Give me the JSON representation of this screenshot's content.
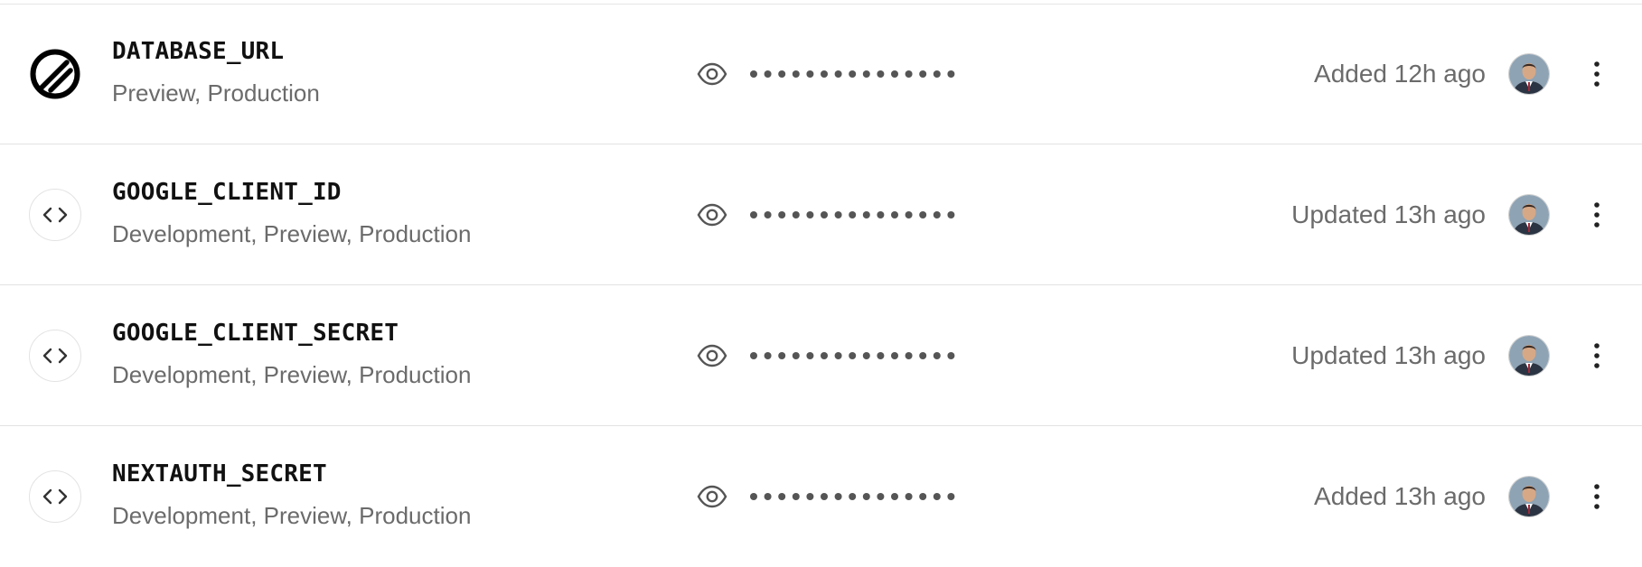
{
  "env_vars": [
    {
      "name": "DATABASE_URL",
      "environments": "Preview, Production",
      "status": "Added 12h ago",
      "icon": "integration-logo-icon"
    },
    {
      "name": "GOOGLE_CLIENT_ID",
      "environments": "Development, Preview, Production",
      "status": "Updated 13h ago",
      "icon": "code-icon"
    },
    {
      "name": "GOOGLE_CLIENT_SECRET",
      "environments": "Development, Preview, Production",
      "status": "Updated 13h ago",
      "icon": "code-icon"
    },
    {
      "name": "NEXTAUTH_SECRET",
      "environments": "Development, Preview, Production",
      "status": "Added 13h ago",
      "icon": "code-icon"
    }
  ],
  "masked_value_dot_count": 15,
  "colors": {
    "text_primary": "#111111",
    "text_secondary": "#6b6b6b",
    "border": "#e2e2e2"
  }
}
